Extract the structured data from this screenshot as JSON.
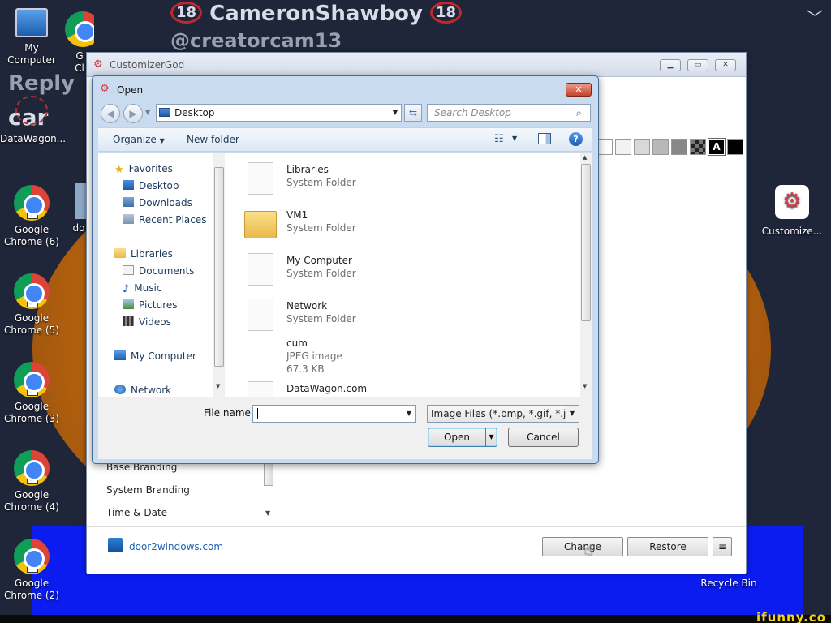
{
  "wallpaper": {
    "title_line": "CameronShawboy",
    "badge_left": "18",
    "badge_right": "18",
    "handle": "@creatorcam13",
    "reply_text": "Reply",
    "partial_text": "car",
    "watermark": "ifunny.co"
  },
  "desktop_icons": [
    {
      "label": "My Computer"
    },
    {
      "label": "G"
    },
    {
      "label": "Cl"
    },
    {
      "label": "DataWagon..."
    },
    {
      "label": "Google Chrome (6)"
    },
    {
      "label": "do"
    },
    {
      "label": "Google Chrome (5)"
    },
    {
      "label": "Google Chrome (3)"
    },
    {
      "label": "Google Chrome (4)"
    },
    {
      "label": "Google Chrome (2)"
    },
    {
      "label": "Customize..."
    },
    {
      "label": "Recycle Bin"
    }
  ],
  "customizer": {
    "title": "CustomizerGod",
    "swatch_letter": "A",
    "nav_items": [
      "Base Branding",
      "System Branding",
      "Time & Date"
    ],
    "footer_link": "door2windows.com",
    "change_label": "Change",
    "restore_label": "Restore",
    "menu_glyph": "≡"
  },
  "dialog": {
    "title": "Open",
    "address": "Desktop",
    "search_placeholder": "Search Desktop",
    "toolbar": {
      "organize": "Organize",
      "new_folder": "New folder"
    },
    "nav": {
      "favorites": "Favorites",
      "favorites_items": [
        "Desktop",
        "Downloads",
        "Recent Places"
      ],
      "libraries": "Libraries",
      "libraries_items": [
        "Documents",
        "Music",
        "Pictures",
        "Videos"
      ],
      "computer": "My Computer",
      "network": "Network"
    },
    "files": [
      {
        "name": "Libraries",
        "sub1": "System Folder",
        "sub2": "",
        "kind": "doc"
      },
      {
        "name": "VM1",
        "sub1": "System Folder",
        "sub2": "",
        "kind": "folder"
      },
      {
        "name": "My Computer",
        "sub1": "System Folder",
        "sub2": "",
        "kind": "doc"
      },
      {
        "name": "Network",
        "sub1": "System Folder",
        "sub2": "",
        "kind": "doc"
      },
      {
        "name": "cum",
        "sub1": "JPEG image",
        "sub2": "67.3 KB",
        "kind": "none"
      },
      {
        "name": "DataWagon.com",
        "sub1": "",
        "sub2": "",
        "kind": "doc"
      }
    ],
    "file_name_label": "File name:",
    "file_name_value": "",
    "file_type": "Image Files (*.bmp, *.gif, *.jpg,",
    "open_label": "Open",
    "cancel_label": "Cancel",
    "help_glyph": "?"
  }
}
